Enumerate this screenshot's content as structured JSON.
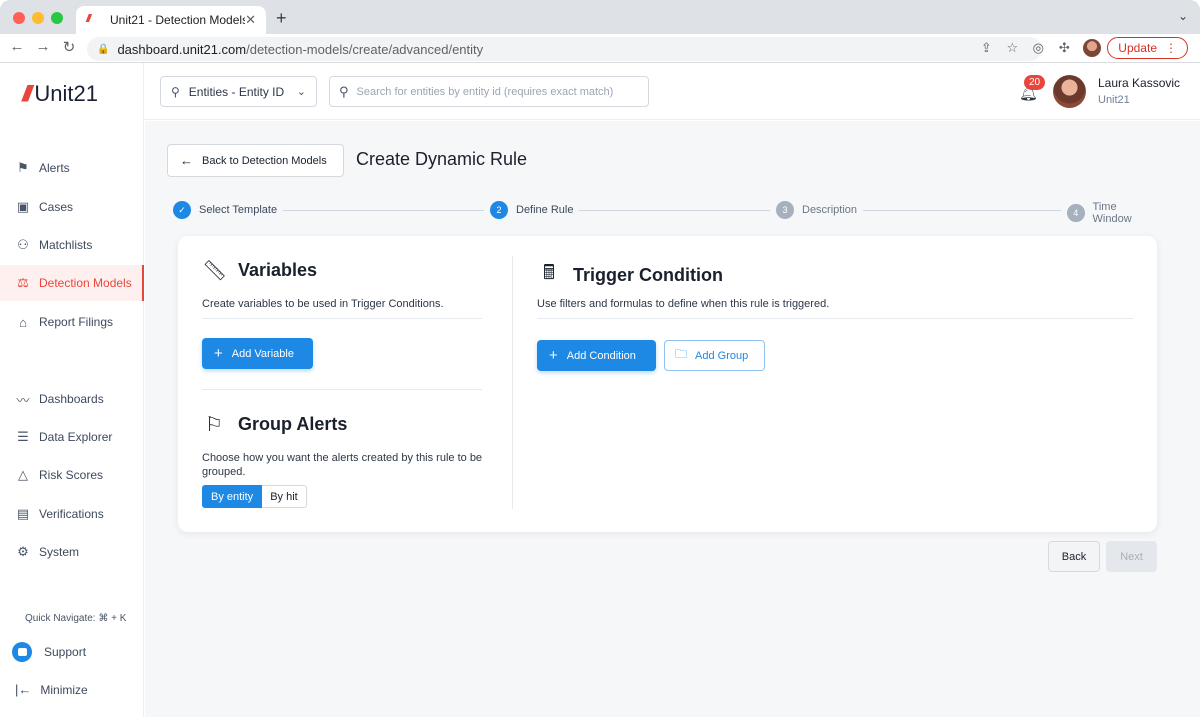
{
  "browser": {
    "tab_title": "Unit21 - Detection Models",
    "tab_close": "✕",
    "new_tab": "+",
    "url_host": "dashboard.unit21.com",
    "url_path": "/detection-models/create/advanced/entity",
    "update_label": "Update"
  },
  "brand": {
    "name": "Unit21",
    "accent": "#e8463d"
  },
  "sidebar": {
    "items": [
      {
        "label": "Alerts",
        "icon": "flag-icon"
      },
      {
        "label": "Cases",
        "icon": "briefcase-icon"
      },
      {
        "label": "Matchlists",
        "icon": "user-x-icon"
      },
      {
        "label": "Detection Models",
        "icon": "scale-icon",
        "active": true
      },
      {
        "label": "Report Filings",
        "icon": "bank-icon"
      },
      {
        "label": "Dashboards",
        "icon": "chart-line-icon"
      },
      {
        "label": "Data Explorer",
        "icon": "data-search-icon"
      },
      {
        "label": "Risk Scores",
        "icon": "warning-icon"
      },
      {
        "label": "Verifications",
        "icon": "id-card-icon"
      },
      {
        "label": "System",
        "icon": "gear-icon"
      }
    ],
    "quick_navigate": "Quick Navigate: ⌘ + K",
    "support": "Support",
    "minimize": "Minimize"
  },
  "topbar": {
    "entity_select": "Entities - Entity ID",
    "search_placeholder": "Search for entities by entity id (requires exact match)",
    "notification_count": "20",
    "user_name": "Laura Kassovic",
    "user_org": "Unit21"
  },
  "page": {
    "back_label": "Back to Detection Models",
    "title": "Create Dynamic Rule"
  },
  "stepper": {
    "steps": [
      {
        "number": "✓",
        "label": "Select Template",
        "state": "done"
      },
      {
        "number": "2",
        "label": "Define Rule",
        "state": "current"
      },
      {
        "number": "3",
        "label": "Description",
        "state": "todo"
      },
      {
        "number": "4",
        "label": "Time Window",
        "state": "todo"
      }
    ]
  },
  "variables": {
    "title": "Variables",
    "description": "Create variables to be used in Trigger Conditions.",
    "add_label": "Add Variable"
  },
  "group_alerts": {
    "title": "Group Alerts",
    "description": "Choose how you want the alerts created by this rule to be grouped.",
    "option_entity": "By entity",
    "option_hit": "By hit",
    "selected": "By entity"
  },
  "trigger": {
    "title": "Trigger Condition",
    "description": "Use filters and formulas to define when this rule is triggered.",
    "add_condition": "Add Condition",
    "add_group": "Add Group"
  },
  "footer": {
    "back": "Back",
    "next": "Next"
  },
  "colors": {
    "primary": "#1e88e5",
    "accent": "#e8463d",
    "step_inactive": "#a7b0bd"
  }
}
